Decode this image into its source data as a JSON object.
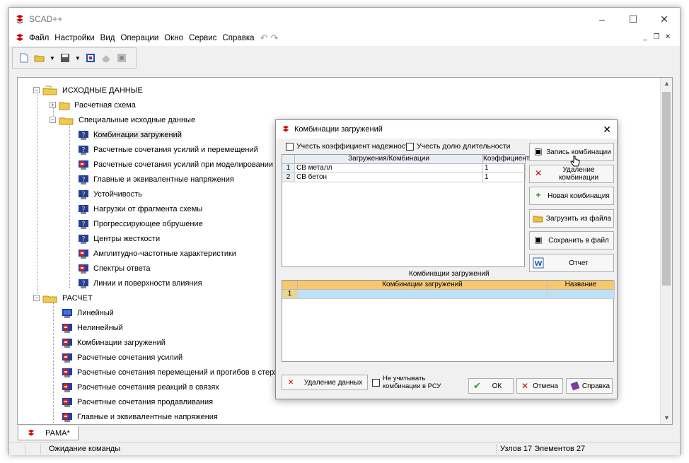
{
  "app": {
    "title": "SCAD++"
  },
  "menu": [
    "Файл",
    "Настройки",
    "Вид",
    "Операции",
    "Окно",
    "Сервис",
    "Справка"
  ],
  "tree": {
    "root1": "ИСХОДНЫЕ ДАННЫЕ",
    "schema": "Расчетная схема",
    "special": "Специальные исходные данные",
    "special_items": [
      "Комбинации загружений",
      "Расчетные сочетания усилий и перемещений",
      "Расчетные сочетания усилий при моделировании нелинейн",
      "Главные и эквивалентные напряжения",
      "Устойчивость",
      "Нагрузки от фрагмента схемы",
      "Прогрессирующее обрушение",
      "Центры жесткости",
      "Амплитудно-частотные характеристики",
      "Спектры ответа",
      "Линии и поверхности влияния"
    ],
    "root2": "РАСЧЕТ",
    "calc_items": [
      "Линейный",
      "Нелинейный",
      "Комбинации загружений",
      "Расчетные сочетания усилий",
      "Расчетные сочетания перемещений и прогибов в стержнях",
      "Расчетные сочетания реакций в связях",
      "Расчетные сочетания продавливания",
      "Главные и эквивалентные напряжения"
    ]
  },
  "doc_tab": "РАМА*",
  "status": {
    "left": "Ожидание команды",
    "right": "Узлов 17 Элементов 27"
  },
  "dialog": {
    "title": "Комбинации загружений",
    "cb_reliability": "Учесть коэффициент надежности",
    "cb_duration": "Учесть долю длительности",
    "grid1": {
      "col_load": "Загружения/Комбинации",
      "col_coef": "Коэффициент",
      "rows": [
        {
          "n": "1",
          "name": "СВ металл",
          "coef": "1"
        },
        {
          "n": "2",
          "name": "СВ бетон",
          "coef": "1"
        }
      ]
    },
    "buttons": {
      "save_comb": "Запись комбинации",
      "delete_comb": "Удаление комбинации",
      "new_comb": "Новая комбинация",
      "load_file": "Загрузить из файла",
      "save_file": "Сохранить в файл",
      "report": "Отчет"
    },
    "section_label": "Комбинации загружений",
    "grid2": {
      "col_comb": "Комбинации загружений",
      "col_name": "Название",
      "row1": "1"
    },
    "bottom": {
      "delete_data": "Удаление данных",
      "ignore_line1": "Не учитывать",
      "ignore_line2": "комбинации в РСУ",
      "ok": "ОК",
      "cancel": "Отмена",
      "help": "Справка"
    }
  }
}
